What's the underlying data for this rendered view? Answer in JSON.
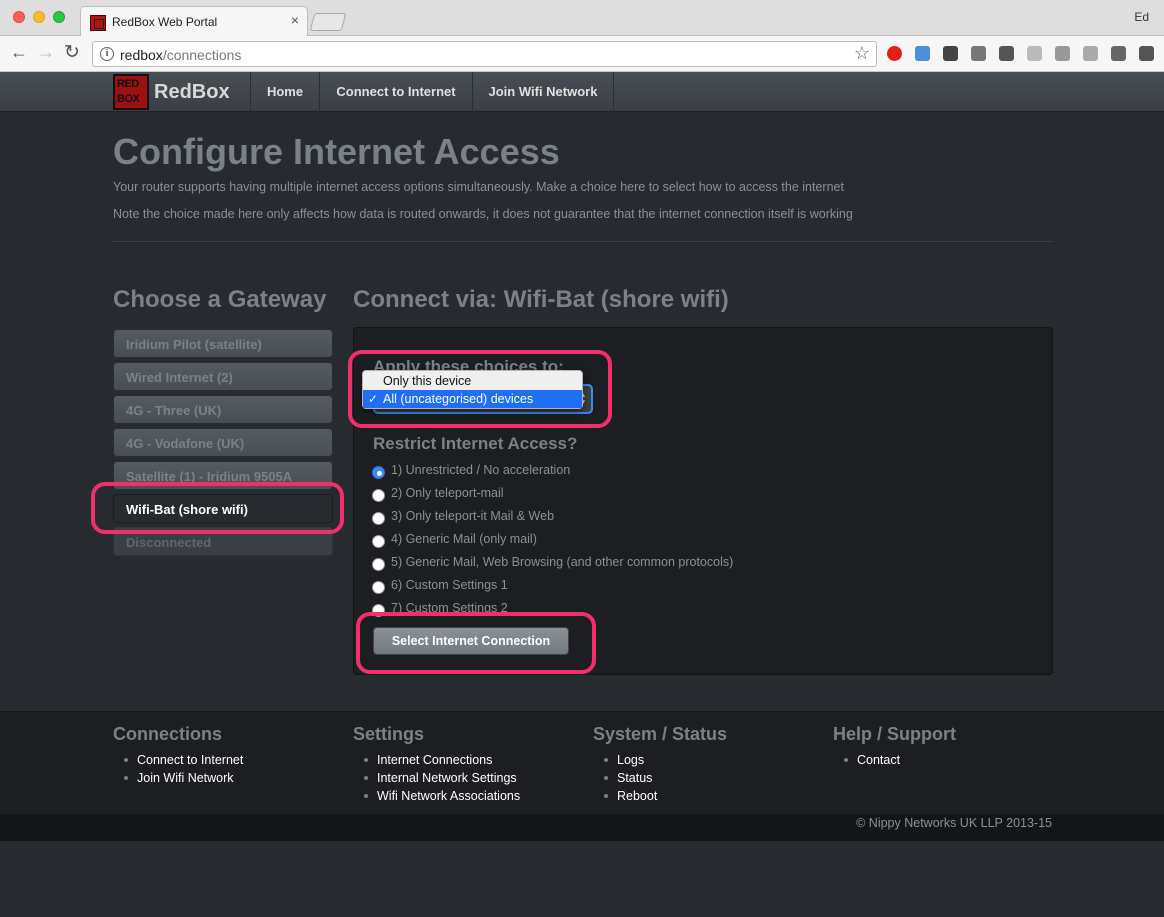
{
  "browser": {
    "tab_title": "RedBox Web Portal",
    "tab_close": "×",
    "profile": "Ed",
    "url_host": "redbox",
    "url_path": "/connections",
    "back": "←",
    "forward": "→",
    "reload": "↻",
    "star": "☆",
    "info": "i",
    "extensions": [
      {
        "name": "opera-icon",
        "color": "#e0201b"
      },
      {
        "name": "folder-icon",
        "color": "#4a8fd9"
      },
      {
        "name": "dots-icon",
        "color": "#444444"
      },
      {
        "name": "shield-icon",
        "color": "#777777"
      },
      {
        "name": "puzzle-icon",
        "color": "#555555"
      },
      {
        "name": "rss-icon",
        "color": "#bbbbbb"
      },
      {
        "name": "reader-icon",
        "color": "#999999"
      },
      {
        "name": "drive-icon",
        "color": "#aaaaaa"
      },
      {
        "name": "cast-icon",
        "color": "#666666"
      },
      {
        "name": "menu-icon",
        "color": "#555555"
      }
    ]
  },
  "navbar": {
    "brand": "RedBox",
    "items": [
      "Home",
      "Connect to Internet",
      "Join Wifi Network"
    ]
  },
  "page": {
    "title": "Configure Internet Access",
    "intro1": "Your router supports having multiple internet access options simultaneously. Make a choice here to select how to access the internet",
    "intro2": "Note the choice made here only affects how data is routed onwards, it does not guarantee that the internet connection itself is working"
  },
  "gateway": {
    "heading": "Choose a Gateway",
    "items": [
      {
        "label": "Iridium Pilot (satellite)",
        "state": "normal"
      },
      {
        "label": "Wired Internet (2)",
        "state": "normal"
      },
      {
        "label": "4G - Three (UK)",
        "state": "normal"
      },
      {
        "label": "4G - Vodafone (UK)",
        "state": "normal"
      },
      {
        "label": "Satellite (1) - Iridium 9505A",
        "state": "normal"
      },
      {
        "label": "Wifi-Bat (shore wifi)",
        "state": "active"
      },
      {
        "label": "Disconnected",
        "state": "disabled"
      }
    ]
  },
  "connect": {
    "heading": "Connect via: Wifi-Bat (shore wifi)",
    "apply_label": "Apply these choices to:",
    "apply_options": [
      "Only this device",
      "All (uncategorised) devices"
    ],
    "apply_selected_index": 1,
    "checkmark": "✓",
    "restrict_label": "Restrict Internet Access?",
    "restrict_options": [
      "1) Unrestricted / No acceleration",
      "2) Only teleport-mail",
      "3) Only teleport-it Mail & Web",
      "4) Generic Mail (only mail)",
      "5) Generic Mail, Web Browsing (and other common protocols)",
      "6) Custom Settings 1",
      "7) Custom Settings 2"
    ],
    "restrict_selected_index": 0,
    "submit_label": "Select Internet Connection"
  },
  "footer": {
    "columns": [
      {
        "title": "Connections",
        "links": [
          "Connect to Internet",
          "Join Wifi Network"
        ]
      },
      {
        "title": "Settings",
        "links": [
          "Internet Connections",
          "Internal Network Settings",
          "Wifi Network Associations"
        ]
      },
      {
        "title": "System / Status",
        "links": [
          "Logs",
          "Status",
          "Reboot"
        ]
      },
      {
        "title": "Help / Support",
        "links": [
          "Contact"
        ]
      }
    ],
    "copyright": "© Nippy Networks UK LLP 2013-15"
  },
  "colors": {
    "highlight": "#f0306a",
    "accent": "#3b8cf2",
    "background": "#272b30"
  }
}
